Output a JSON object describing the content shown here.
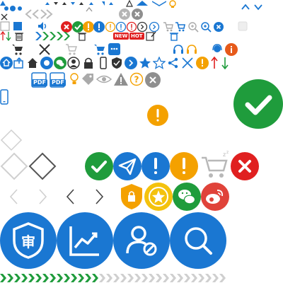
{
  "colors": {
    "blue": "#1a77d2",
    "green": "#1f9c3c",
    "red": "#e02020",
    "orange": "#f4a100",
    "grey": "#9a9a9a",
    "light_grey": "#cfcfcf",
    "dark": "#333333"
  },
  "badges": {
    "new_label": "NEW",
    "hot_label": "HOT"
  },
  "file_badges": {
    "pdf_label_1": "PDF",
    "pdf_label_2": "PDF"
  },
  "big_icons": {
    "approve_glyph": "审"
  },
  "icons": [
    "triangle-icon",
    "dots-icon",
    "chevron-left-icon",
    "chevron-right-icon",
    "caret-icon",
    "warning-icon",
    "lightbulb-icon",
    "close-circle-icon",
    "chevron-up-icon",
    "chevron-down-icon",
    "trash-icon",
    "speaker-icon",
    "error-icon",
    "success-icon",
    "info-icon",
    "search-icon",
    "zoom-in-icon",
    "shopping-cart-icon",
    "edit-icon",
    "refresh-icon",
    "headset-icon",
    "home-icon",
    "share-icon",
    "user-icon",
    "lock-icon",
    "mobile-icon",
    "shield-icon",
    "star-icon",
    "tag-icon",
    "eye-icon",
    "question-icon",
    "pdf-icon",
    "send-icon",
    "wechat-icon",
    "weibo-icon",
    "approve-icon",
    "chart-icon",
    "user-block-icon",
    "diamond-icon"
  ]
}
